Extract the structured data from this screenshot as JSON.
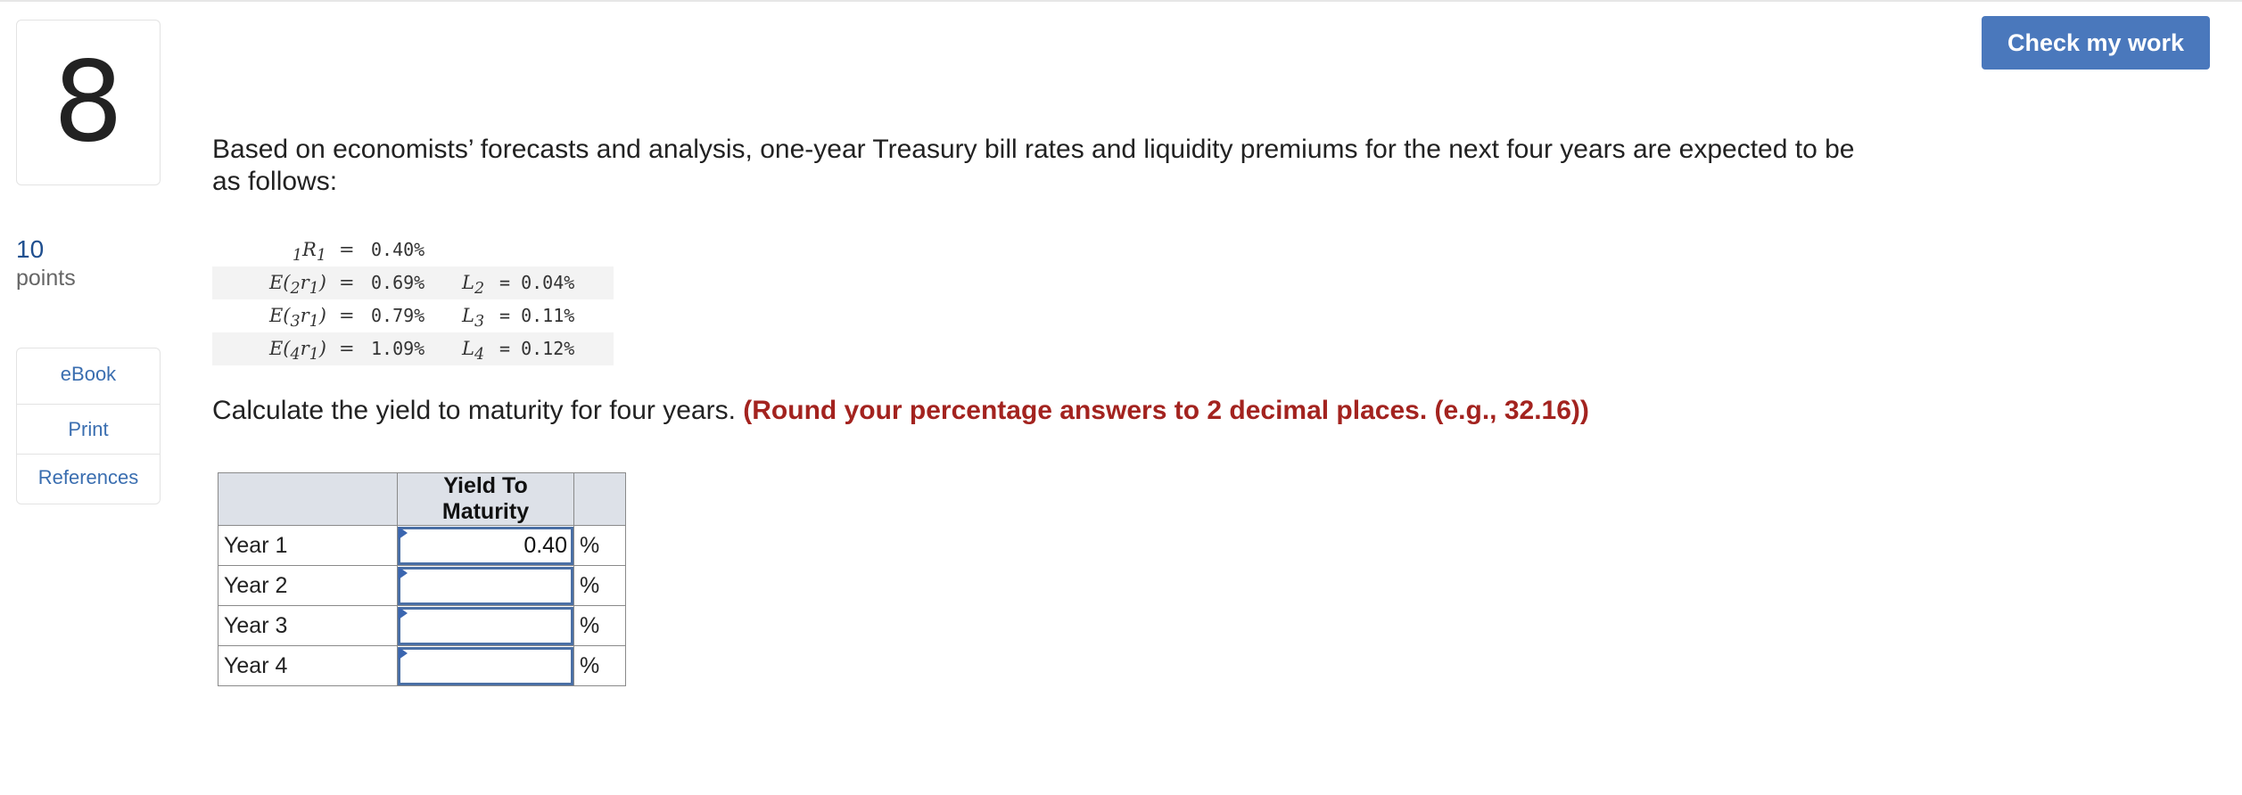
{
  "question": {
    "number": "8",
    "points_value": "10",
    "points_label": "points"
  },
  "side_links": [
    {
      "label": "eBook"
    },
    {
      "label": "Print"
    },
    {
      "label": "References"
    }
  ],
  "actions": {
    "check_label": "Check my work"
  },
  "intro_text": "Based on economists’ forecasts and analysis, one-year Treasury bill rates and liquidity premiums for the next four years are expected to be as follows:",
  "rates": [
    {
      "pre": "",
      "sub_lead": "1",
      "mid": "R",
      "sub_tail": "1",
      "post": "",
      "value": "0.40%",
      "premium_name": "",
      "premium_sub": "",
      "premium_value": ""
    },
    {
      "pre": "E(",
      "sub_lead": "2",
      "mid": "r",
      "sub_tail": "1",
      "post": ")",
      "value": "0.69%",
      "premium_name": "L",
      "premium_sub": "2",
      "premium_value": "= 0.04%"
    },
    {
      "pre": "E(",
      "sub_lead": "3",
      "mid": "r",
      "sub_tail": "1",
      "post": ")",
      "value": "0.79%",
      "premium_name": "L",
      "premium_sub": "3",
      "premium_value": "= 0.11%"
    },
    {
      "pre": "E(",
      "sub_lead": "4",
      "mid": "r",
      "sub_tail": "1",
      "post": ")",
      "value": "1.09%",
      "premium_name": "L",
      "premium_sub": "4",
      "premium_value": "= 0.12%"
    }
  ],
  "equals_sign": "=",
  "instruction": {
    "text": "Calculate the yield to maturity for four years.",
    "note": "(Round your percentage answers to 2 decimal places. (e.g., 32.16))"
  },
  "table": {
    "header_blank": "",
    "header": "Yield To Maturity",
    "unit": "%",
    "rows": [
      {
        "label": "Year 1",
        "value": "0.40"
      },
      {
        "label": "Year 2",
        "value": ""
      },
      {
        "label": "Year 3",
        "value": ""
      },
      {
        "label": "Year 4",
        "value": ""
      }
    ]
  }
}
